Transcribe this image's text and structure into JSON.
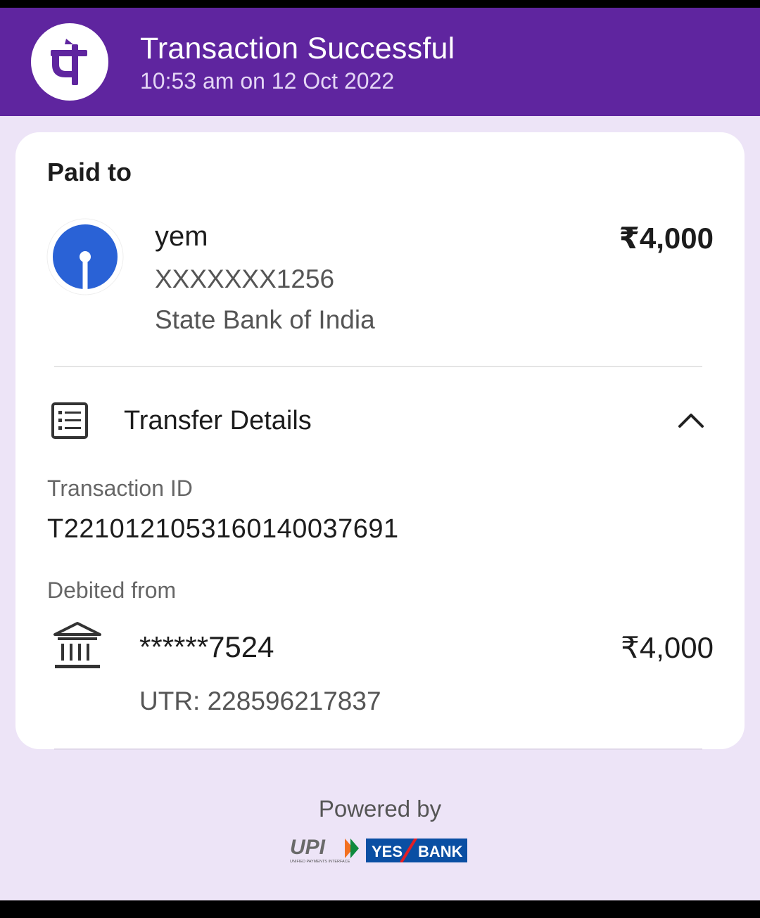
{
  "header": {
    "title": "Transaction Successful",
    "subtitle": "10:53 am on 12 Oct 2022",
    "logo_icon": "phonepe-logo",
    "bg_color": "#5f259f"
  },
  "payee": {
    "section_label": "Paid to",
    "name": "yem",
    "account": "XXXXXXX1256",
    "bank": "State Bank of India",
    "amount": "₹4,000",
    "bank_icon": "sbi-logo"
  },
  "transfer_details": {
    "title": "Transfer Details",
    "icon": "receipt-list-icon",
    "toggle_icon": "chevron-up-icon",
    "transaction_id_label": "Transaction ID",
    "transaction_id": "T2210121053160140037691",
    "debited_from_label": "Debited from",
    "debit_account": "******7524",
    "debit_amount": "₹4,000",
    "utr": "UTR: 228596217837",
    "debit_icon": "bank-icon"
  },
  "footer": {
    "powered_by": "Powered by",
    "upi_text": "UPI",
    "upi_subtext": "UNIFIED PAYMENTS INTERFACE",
    "yes_bank_text_1": "YES",
    "yes_bank_text_2": "BANK"
  }
}
